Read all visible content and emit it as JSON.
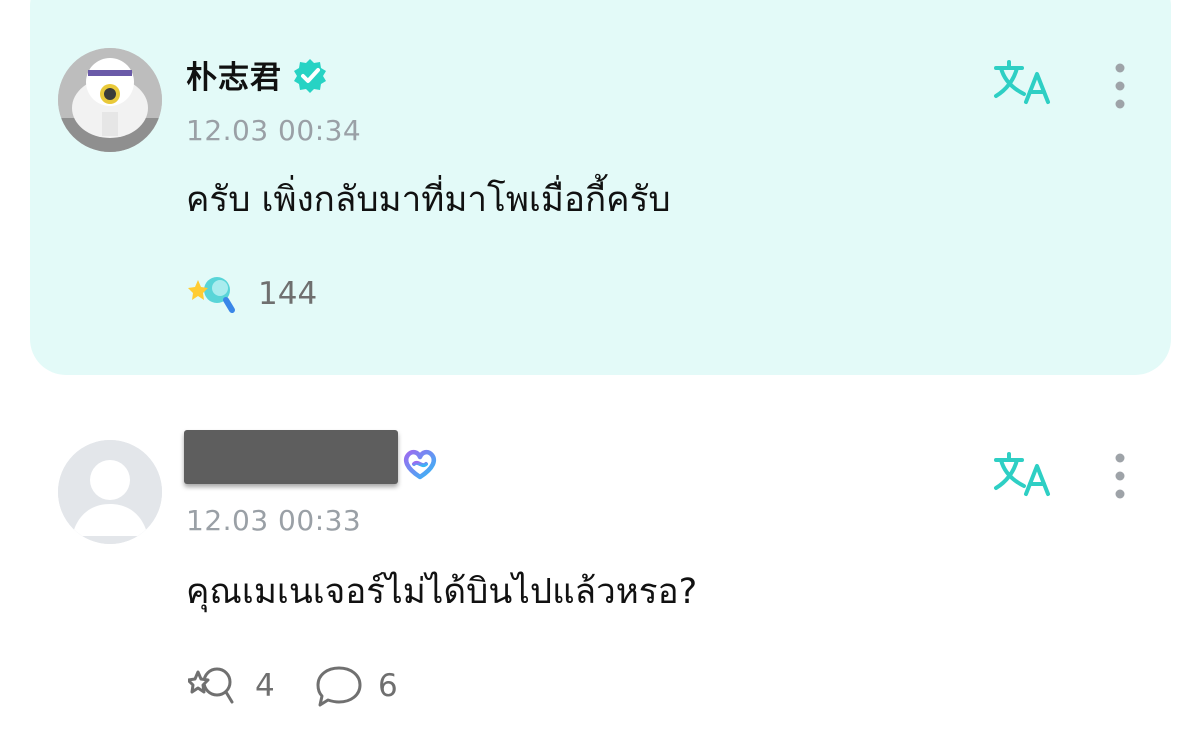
{
  "comments": [
    {
      "author": "朴志君",
      "verified_badge": "verified-check-icon",
      "badge_color": "#27d3c4",
      "time": "12.03 00:34",
      "text": "ครับ เพิ่งกลับมาที่มาโพเมื่อกี้ครับ",
      "reaction_icon": "sparkle-reaction-icon",
      "reaction_count": "144",
      "highlighted": true,
      "highlight_color": "#e3faf8"
    },
    {
      "author_redacted": true,
      "member_badge": "membership-heart-icon",
      "time": "12.03 00:33",
      "text": "คุณเมเนเจอร์ไม่ได้บินไปแล้วหรอ?",
      "reaction_icon": "reaction-outline-icon",
      "reaction_count": "4",
      "reply_icon": "speech-bubble-icon",
      "reply_count": "6"
    }
  ],
  "icons": {
    "translate": "translate-icon",
    "more": "more-vertical-icon"
  },
  "colors": {
    "accent": "#2ecfc4",
    "muted_text": "#9aa0a6",
    "count_text": "#6f6f6f"
  }
}
